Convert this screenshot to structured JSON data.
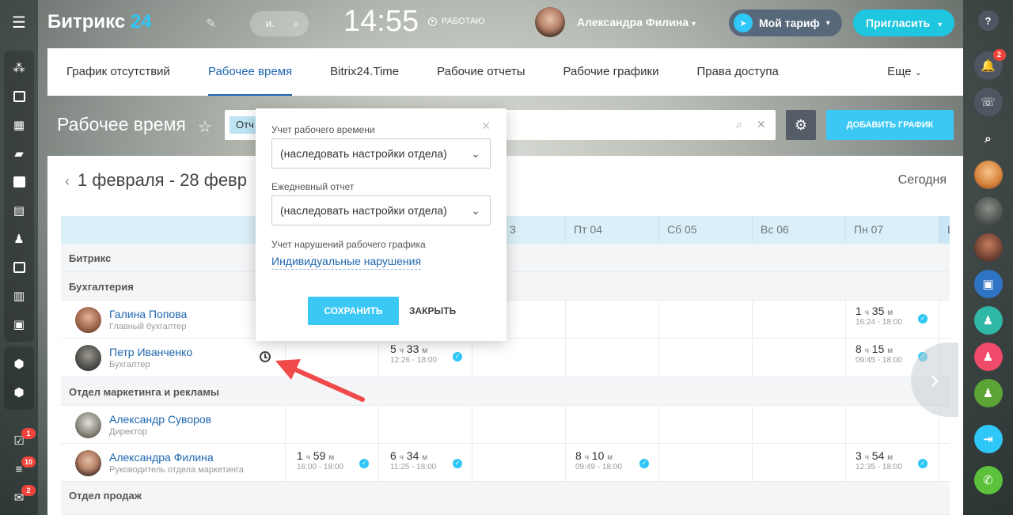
{
  "header": {
    "logo_main": "Битрикс",
    "logo_num": "24",
    "search_placeholder": "и.",
    "time": "14:55",
    "status": "РАБОТАЮ",
    "user_name": "Александра Филина",
    "tariff": "Мой тариф",
    "invite": "Пригласить"
  },
  "tabs": [
    "График отсутствий",
    "Рабочее время",
    "Bitrix24.Time",
    "Рабочие отчеты",
    "Рабочие графики",
    "Права доступа"
  ],
  "tab_more": "Еще",
  "page": {
    "title": "Рабочее время",
    "filter_chip": "Отч",
    "add_button": "ДОБАВИТЬ ГРАФИК",
    "period": "1 февраля - 28 февр",
    "today": "Сегодня"
  },
  "grid": {
    "days": [
      "3",
      "Пт 04",
      "Сб 05",
      "Вс 06",
      "Пн 07",
      "В"
    ],
    "groups": [
      "Битрикс",
      "Бухгалтерия",
      "Отдел маркетинга и рекламы",
      "Отдел продаж"
    ],
    "people": [
      {
        "name": "Галина Попова",
        "position": "Главный бухгалтер"
      },
      {
        "name": "Петр Иванченко",
        "position": "Бухгалтер"
      },
      {
        "name": "Александр Суворов",
        "position": "Директор"
      },
      {
        "name": "Александра Филина",
        "position": "Руководитель отдела маркетинга"
      }
    ],
    "entries": {
      "galina_mon": {
        "h": "1",
        "m": "35",
        "range": "16:24 - 18:00"
      },
      "petr_d2": {
        "h": "5",
        "m": "33",
        "range": "12:26 - 18:00"
      },
      "petr_mon": {
        "h": "8",
        "m": "15",
        "range": "09:45 - 18:00"
      },
      "alex_d1": {
        "h": "1",
        "m": "59",
        "range": "16:00 - 18:00"
      },
      "alex_d2": {
        "h": "6",
        "m": "34",
        "range": "11:25 - 18:00"
      },
      "alex_fri": {
        "h": "8",
        "m": "10",
        "range": "09:49 - 18:00"
      },
      "alex_mon": {
        "h": "3",
        "m": "54",
        "range": "12:35 - 18:00"
      }
    },
    "unit_h": "ч",
    "unit_m": "м"
  },
  "popup": {
    "label1": "Учет рабочего времени",
    "select1": "(наследовать настройки отдела)",
    "label2": "Ежедневный отчет",
    "select2": "(наследовать настройки отдела)",
    "label3": "Учет нарушений рабочего графика",
    "link": "Индивидуальные нарушения",
    "save": "СОХРАНИТЬ",
    "close": "ЗАКРЫТЬ"
  },
  "left_badges": {
    "tasks": "1",
    "feed": "10",
    "mail": "2"
  },
  "right_badges": {
    "notifications": "2"
  }
}
